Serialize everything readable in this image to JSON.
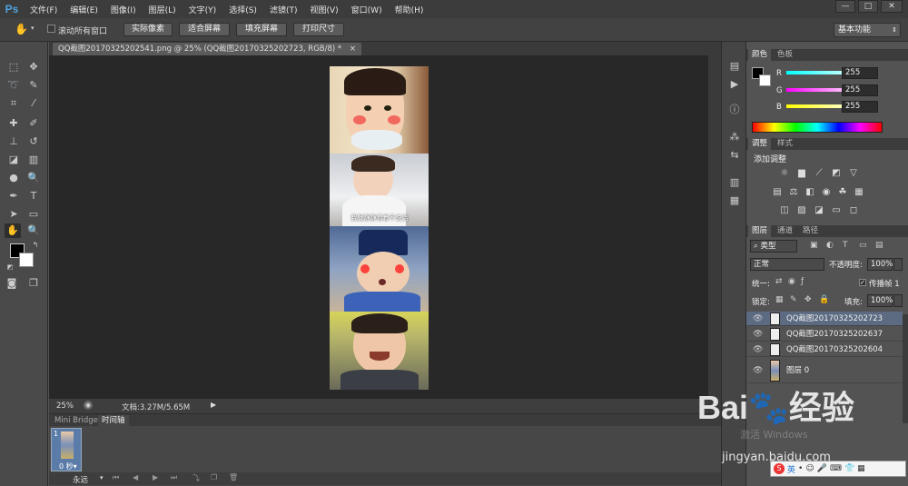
{
  "app": {
    "logo": "Ps"
  },
  "menu": [
    "文件(F)",
    "编辑(E)",
    "图像(I)",
    "图层(L)",
    "文字(Y)",
    "选择(S)",
    "滤镜(T)",
    "视图(V)",
    "窗口(W)",
    "帮助(H)"
  ],
  "window_controls": {
    "minimize": "—",
    "maximize": "□",
    "close": "✕"
  },
  "options": {
    "scroll_all": "滚动所有窗口",
    "buttons": [
      "实际像素",
      "适合屏幕",
      "填充屏幕",
      "打印尺寸"
    ],
    "workspace": "基本功能"
  },
  "document": {
    "tab_title": "QQ截图20170325202541.png @ 25% (QQ截图20170325202723, RGB/8) *",
    "tab_close": "×",
    "zoom": "25%",
    "doc_size": "文档:3.27M/5.65M",
    "photo_caption": "我就静静看着不说话"
  },
  "timeline": {
    "tabs": [
      "Mini Bridge",
      "时间轴"
    ],
    "frame_number": "1",
    "frame_delay": "0 秒▾",
    "loop": "永远"
  },
  "color_panel": {
    "tabs": [
      "颜色",
      "色板"
    ],
    "channels": [
      {
        "label": "R",
        "value": "255"
      },
      {
        "label": "G",
        "value": "255"
      },
      {
        "label": "B",
        "value": "255"
      }
    ]
  },
  "adjust_panel": {
    "tabs": [
      "调整",
      "样式"
    ],
    "title": "添加调整"
  },
  "layers_panel": {
    "tabs": [
      "图层",
      "通道",
      "路径"
    ],
    "filter_kind": "类型",
    "blend_mode": "正常",
    "opacity_label": "不透明度:",
    "opacity_value": "100%",
    "unify_label": "统一:",
    "propagate_label": "传播帧 1",
    "lock_label": "锁定:",
    "fill_label": "填充:",
    "fill_value": "100%",
    "layers": [
      {
        "name": "QQ截图20170325202723",
        "selected": true
      },
      {
        "name": "QQ截图20170325202637",
        "selected": false
      },
      {
        "name": "QQ截图20170325202604",
        "selected": false
      },
      {
        "name": "图层 0",
        "selected": false
      }
    ]
  },
  "watermark": {
    "brand": "Bai🐾经验",
    "url": "jingyan.baidu.com",
    "activate": "激活 Windows"
  },
  "ime": {
    "label": "英"
  }
}
